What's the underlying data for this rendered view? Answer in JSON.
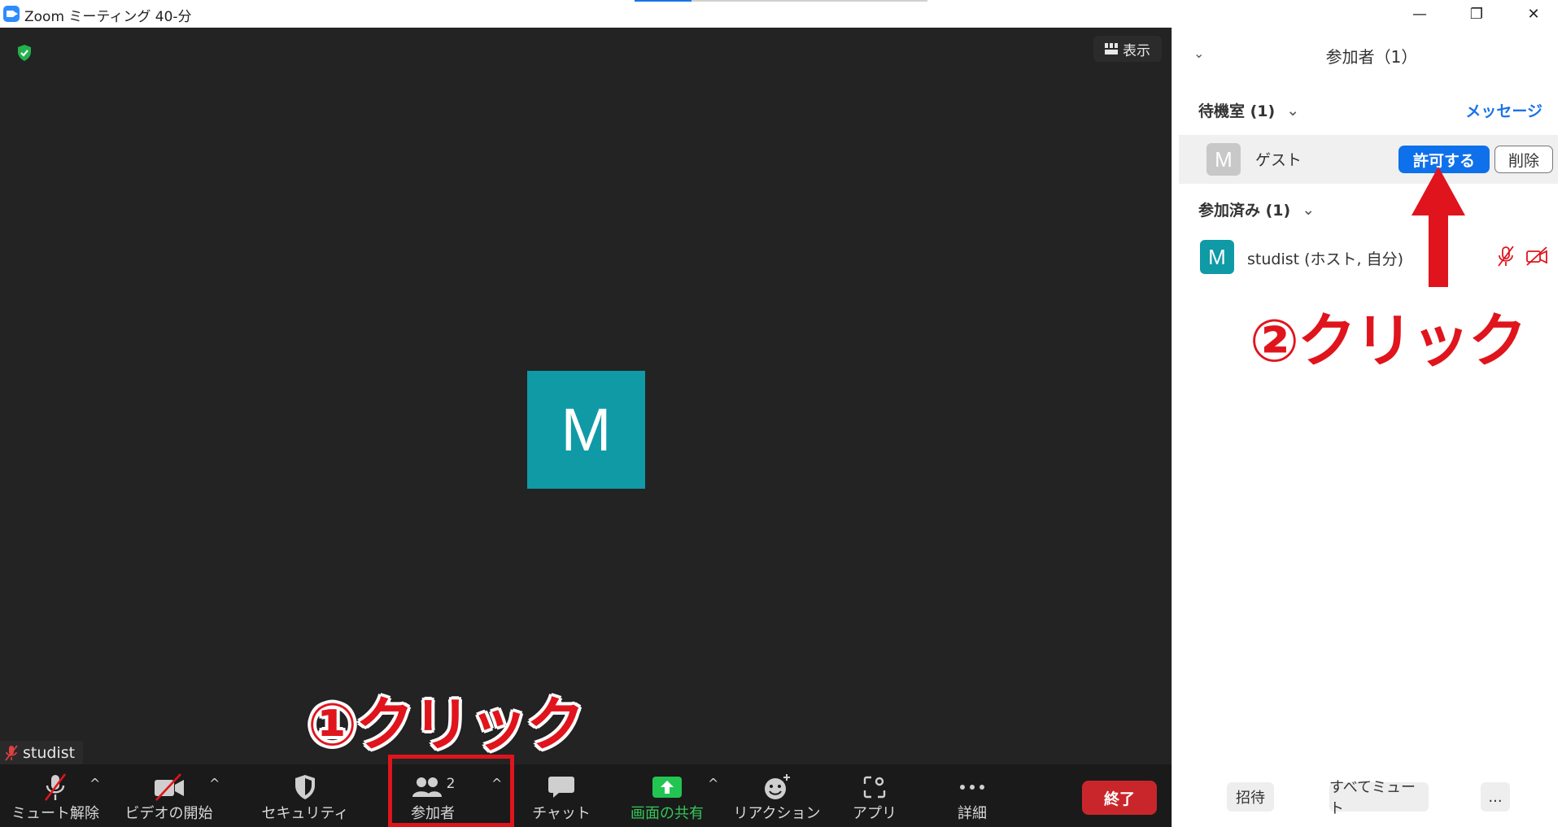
{
  "window": {
    "title": "Zoom ミーティング 40-分",
    "controls": [
      "—",
      "❐",
      "✕"
    ]
  },
  "video": {
    "view_label": "表示",
    "avatar_letter": "M",
    "name_tag": "studist"
  },
  "toolbar": {
    "unmute": "ミュート解除",
    "start_video": "ビデオの開始",
    "security": "セキュリティ",
    "participants": "参加者",
    "participants_count": "2",
    "chat": "チャット",
    "share": "画面の共有",
    "reactions": "リアクション",
    "apps": "アプリ",
    "more": "詳細",
    "end": "終了"
  },
  "annotations": {
    "step1": "①クリック",
    "step2": "②クリック"
  },
  "panel": {
    "title": "参加者（1）",
    "waiting_room": {
      "label": "待機室 (1)",
      "message_link": "メッセージ",
      "guest": {
        "avatar_letter": "M",
        "name": "ゲスト",
        "admit": "許可する",
        "remove": "削除"
      }
    },
    "joined": {
      "label": "参加済み (1)",
      "host": {
        "avatar_letter": "M",
        "name": "studist (ホスト, 自分)"
      }
    },
    "footer": {
      "invite": "招待",
      "mute_all": "すべてミュート",
      "more": "..."
    }
  },
  "colors": {
    "accent_blue": "#0e71eb",
    "avatar_teal": "#0f9aa6",
    "end_red": "#c9262b",
    "annotation_red": "#e0141c",
    "share_green": "#35c759"
  }
}
